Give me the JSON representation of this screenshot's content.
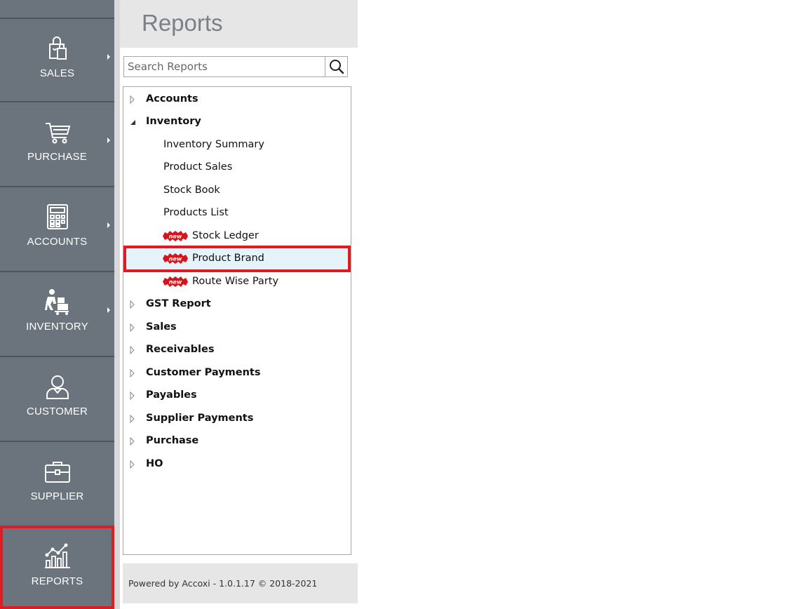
{
  "sidebar": {
    "items": [
      {
        "label": "SALES",
        "icon": "shopping-bag-icon",
        "has_submenu": true
      },
      {
        "label": "PURCHASE",
        "icon": "cart-icon",
        "has_submenu": true
      },
      {
        "label": "ACCOUNTS",
        "icon": "calculator-icon",
        "has_submenu": true
      },
      {
        "label": "INVENTORY",
        "icon": "worker-boxes-icon",
        "has_submenu": true
      },
      {
        "label": "CUSTOMER",
        "icon": "user-icon",
        "has_submenu": false
      },
      {
        "label": "SUPPLIER",
        "icon": "briefcase-icon",
        "has_submenu": false
      },
      {
        "label": "REPORTS",
        "icon": "bar-chart-icon",
        "has_submenu": false,
        "active": true
      }
    ]
  },
  "reports": {
    "title": "Reports",
    "search": {
      "placeholder": "Search Reports",
      "value": ""
    },
    "tree": [
      {
        "label": "Accounts",
        "type": "group",
        "expanded": false
      },
      {
        "label": "Inventory",
        "type": "group",
        "expanded": true
      },
      {
        "label": "Inventory Summary",
        "type": "leaf"
      },
      {
        "label": "Product Sales",
        "type": "leaf"
      },
      {
        "label": "Stock Book",
        "type": "leaf"
      },
      {
        "label": "Products List",
        "type": "leaf"
      },
      {
        "label": "Stock Ledger",
        "type": "leaf",
        "badge": "new"
      },
      {
        "label": "Product Brand",
        "type": "leaf",
        "badge": "new",
        "selected": true
      },
      {
        "label": "Route Wise Party",
        "type": "leaf",
        "badge": "new"
      },
      {
        "label": "GST Report",
        "type": "group",
        "expanded": false
      },
      {
        "label": "Sales",
        "type": "group",
        "expanded": false
      },
      {
        "label": "Receivables",
        "type": "group",
        "expanded": false
      },
      {
        "label": "Customer Payments",
        "type": "group",
        "expanded": false
      },
      {
        "label": "Payables",
        "type": "group",
        "expanded": false
      },
      {
        "label": "Supplier Payments",
        "type": "group",
        "expanded": false
      },
      {
        "label": "Purchase",
        "type": "group",
        "expanded": false
      },
      {
        "label": "HO",
        "type": "group",
        "expanded": false
      }
    ],
    "footer": "Powered by Accoxi - 1.0.1.17 © 2018-2021"
  },
  "colors": {
    "sidebar_bg": "#6b747c",
    "highlight": "#e11b22",
    "badge_red": "#d7141b",
    "selected_row": "#e5f3fb"
  }
}
